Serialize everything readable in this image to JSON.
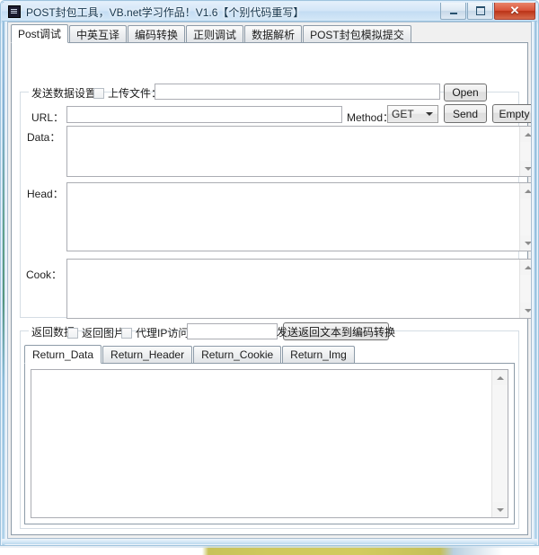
{
  "window": {
    "title": "POST封包工具，VB.net学习作品！V1.6【个别代码重写】",
    "icon": "app-icon",
    "buttons": {
      "minimize": "minimize-icon",
      "maximize": "maximize-icon",
      "close": "✕"
    },
    "accent_color": "#cfe5f7",
    "close_color": "#bb3317"
  },
  "main_tabs": [
    {
      "label": "Post调试",
      "active": true
    },
    {
      "label": "中英互译",
      "active": false
    },
    {
      "label": "编码转换",
      "active": false
    },
    {
      "label": "正则调试",
      "active": false
    },
    {
      "label": "数据解析",
      "active": false
    },
    {
      "label": "POST封包模拟提交",
      "active": false
    }
  ],
  "send_group": {
    "title": "发送数据设置",
    "upload_checkbox": {
      "label": "上传文件：",
      "checked": false
    },
    "upload_path": {
      "value": "",
      "placeholder": ""
    },
    "open_button": "Open",
    "url_label": "URL：",
    "url_value": "",
    "method_label": "Method：",
    "method_value": "GET",
    "send_button": "Send",
    "empty_button": "Empty",
    "data_label": "Data：",
    "data_value": "",
    "head_label": "Head：",
    "head_value": "",
    "cook_label": "Cook：",
    "cook_value": ""
  },
  "return_group": {
    "title": "返回数据",
    "return_img_checkbox": {
      "label": "返回图片",
      "checked": false
    },
    "proxy_checkbox": {
      "label": "代理IP访问：",
      "checked": false
    },
    "proxy_value": "",
    "send_to_encode_button": "发送返回文本到编码转换",
    "tabs": [
      {
        "label": "Return_Data",
        "active": true
      },
      {
        "label": "Return_Header",
        "active": false
      },
      {
        "label": "Return_Cookie",
        "active": false
      },
      {
        "label": "Return_Img",
        "active": false
      }
    ],
    "content": ""
  }
}
